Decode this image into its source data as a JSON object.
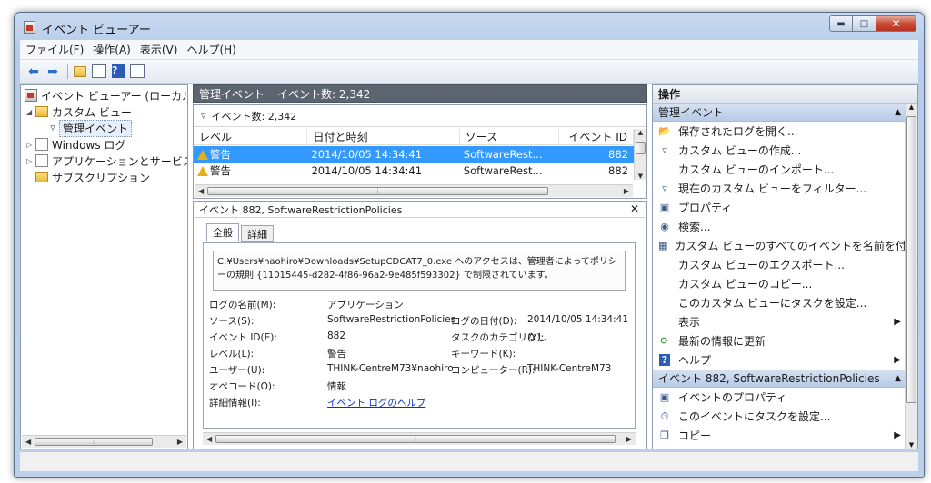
{
  "window": {
    "title": "イベント ビューアー"
  },
  "menu": [
    "ファイル(F)",
    "操作(A)",
    "表示(V)",
    "ヘルプ(H)"
  ],
  "toolbar": {
    "icons": [
      "back-arrow-icon",
      "forward-arrow-icon",
      "folder-up-icon",
      "show-hide-tree-icon",
      "help-icon",
      "show-hide-action-icon"
    ]
  },
  "tree": {
    "root": "イベント ビューアー (ローカル)",
    "custom_views": "カスタム ビュー",
    "admin_events": "管理イベント",
    "windows_logs": "Windows ログ",
    "app_service_logs": "アプリケーションとサービス ログ",
    "subscriptions": "サブスクリプション"
  },
  "center": {
    "header_title": "管理イベント",
    "header_count": "イベント数: 2,342",
    "filter_text": "イベント数: 2,342",
    "columns": [
      "レベル",
      "日付と時刻",
      "ソース",
      "イベント ID"
    ],
    "rows": [
      {
        "level": "警告",
        "datetime": "2014/10/05 14:34:41",
        "source": "SoftwareRest...",
        "id": "882"
      },
      {
        "level": "警告",
        "datetime": "2014/10/05 14:34:41",
        "source": "SoftwareRest...",
        "id": "882"
      }
    ],
    "detail_title": "イベント 882, SoftwareRestrictionPolicies",
    "tabs": [
      "全般",
      "詳細"
    ],
    "message": "C:¥Users¥naohiro¥Downloads¥SetupCDCAT7_0.exe へのアクセスは、管理者によってポリシーの規則 {11015445-d282-4f86-96a2-9e485f593302} で制限されています。",
    "labels": {
      "log_name": "ログの名前(M):",
      "source": "ソース(S):",
      "event_id": "イベント ID(E):",
      "level": "レベル(L):",
      "user": "ユーザー(U):",
      "opcode": "オペコード(O):",
      "more_info": "詳細情報(I):",
      "logged": "ログの日付(D):",
      "task_category": "タスクのカテゴリ(Y):",
      "keywords": "キーワード(K):",
      "computer": "コンピューター(R):"
    },
    "values": {
      "log_name": "アプリケーション",
      "source": "SoftwareRestrictionPolicies",
      "event_id": "882",
      "level": "警告",
      "user": "THINK-CentreM73¥naohiro",
      "opcode": "情報",
      "more_info": "イベント ログのヘルプ",
      "logged": "2014/10/05 14:34:41",
      "task_category": "なし",
      "keywords": "",
      "computer": "THINK-CentreM73"
    }
  },
  "actions": {
    "header": "操作",
    "section1": "管理イベント",
    "items1": [
      "保存されたログを開く...",
      "カスタム ビューの作成...",
      "カスタム ビューのインポート...",
      "現在のカスタム ビューをフィルター...",
      "プロパティ",
      "検索...",
      "カスタム ビューのすべてのイベントを名前を付...",
      "カスタム ビューのエクスポート...",
      "カスタム ビューのコピー...",
      "このカスタム ビューにタスクを設定...",
      "表示",
      "最新の情報に更新",
      "ヘルプ"
    ],
    "section2": "イベント 882, SoftwareRestrictionPolicies",
    "items2": [
      "イベントのプロパティ",
      "このイベントにタスクを設定...",
      "コピー"
    ]
  },
  "colors": {
    "selection": "#3399ff",
    "warning": "#e5b112",
    "header_dark": "#5c6470",
    "link": "#0033cc"
  }
}
